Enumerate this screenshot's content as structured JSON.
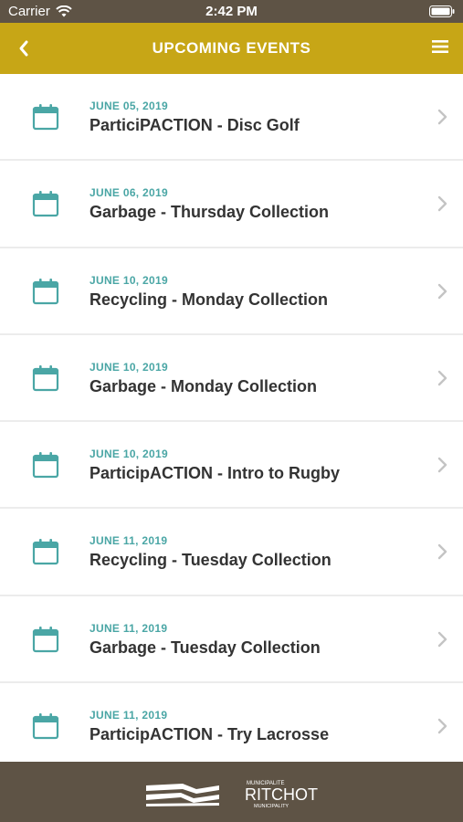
{
  "status": {
    "carrier": "Carrier",
    "time": "2:42 PM"
  },
  "nav": {
    "title": "UPCOMING EVENTS"
  },
  "events": [
    {
      "date": "JUNE 05, 2019",
      "name": "ParticiPACTION - Disc Golf"
    },
    {
      "date": "JUNE 06, 2019",
      "name": "Garbage - Thursday Collection"
    },
    {
      "date": "JUNE 10, 2019",
      "name": "Recycling - Monday Collection"
    },
    {
      "date": "JUNE 10, 2019",
      "name": "Garbage - Monday Collection"
    },
    {
      "date": "JUNE 10, 2019",
      "name": "ParticipACTION - Intro to Rugby"
    },
    {
      "date": "JUNE 11, 2019",
      "name": "Recycling - Tuesday Collection"
    },
    {
      "date": "JUNE 11, 2019",
      "name": "Garbage - Tuesday Collection"
    },
    {
      "date": "JUNE 11, 2019",
      "name": "ParticipACTION - Try Lacrosse"
    }
  ],
  "footer": {
    "logo_top": "MUNICIPALITÉ",
    "logo_name": "RITCHOT",
    "logo_bottom": "MUNICIPALITY"
  },
  "colors": {
    "accent": "#c7a616",
    "brand_dark": "#5e5345",
    "date_teal": "#4aa6a5"
  },
  "icons": {
    "back": "chevron-left-icon",
    "menu": "hamburger-menu-icon",
    "event": "calendar-icon",
    "row": "chevron-right-icon"
  }
}
